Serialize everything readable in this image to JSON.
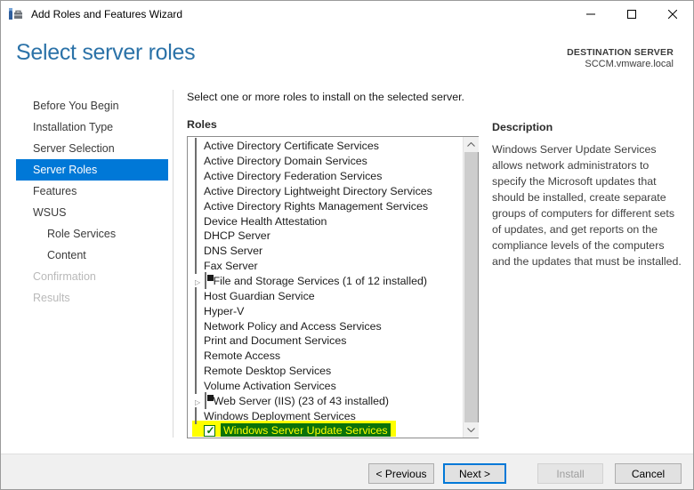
{
  "window": {
    "title": "Add Roles and Features Wizard"
  },
  "header": {
    "title": "Select server roles",
    "destination_label": "DESTINATION SERVER",
    "destination_server": "SCCM.vmware.local"
  },
  "sidebar": {
    "items": [
      {
        "label": "Before You Begin",
        "state": "normal",
        "indent": 0
      },
      {
        "label": "Installation Type",
        "state": "normal",
        "indent": 0
      },
      {
        "label": "Server Selection",
        "state": "normal",
        "indent": 0
      },
      {
        "label": "Server Roles",
        "state": "selected",
        "indent": 0
      },
      {
        "label": "Features",
        "state": "normal",
        "indent": 0
      },
      {
        "label": "WSUS",
        "state": "normal",
        "indent": 0
      },
      {
        "label": "Role Services",
        "state": "normal",
        "indent": 1
      },
      {
        "label": "Content",
        "state": "normal",
        "indent": 1
      },
      {
        "label": "Confirmation",
        "state": "disabled",
        "indent": 0
      },
      {
        "label": "Results",
        "state": "disabled",
        "indent": 0
      }
    ]
  },
  "main": {
    "instruction": "Select one or more roles to install on the selected server.",
    "roles_label": "Roles",
    "roles": [
      {
        "label": "Active Directory Certificate Services",
        "check": "unchecked",
        "expandable": false,
        "highlighted": false
      },
      {
        "label": "Active Directory Domain Services",
        "check": "unchecked",
        "expandable": false,
        "highlighted": false
      },
      {
        "label": "Active Directory Federation Services",
        "check": "unchecked",
        "expandable": false,
        "highlighted": false
      },
      {
        "label": "Active Directory Lightweight Directory Services",
        "check": "unchecked",
        "expandable": false,
        "highlighted": false
      },
      {
        "label": "Active Directory Rights Management Services",
        "check": "unchecked",
        "expandable": false,
        "highlighted": false
      },
      {
        "label": "Device Health Attestation",
        "check": "unchecked",
        "expandable": false,
        "highlighted": false
      },
      {
        "label": "DHCP Server",
        "check": "unchecked",
        "expandable": false,
        "highlighted": false
      },
      {
        "label": "DNS Server",
        "check": "unchecked",
        "expandable": false,
        "highlighted": false
      },
      {
        "label": "Fax Server",
        "check": "unchecked",
        "expandable": false,
        "highlighted": false
      },
      {
        "label": "File and Storage Services (1 of 12 installed)",
        "check": "partial",
        "expandable": true,
        "highlighted": false
      },
      {
        "label": "Host Guardian Service",
        "check": "unchecked",
        "expandable": false,
        "highlighted": false
      },
      {
        "label": "Hyper-V",
        "check": "unchecked",
        "expandable": false,
        "highlighted": false
      },
      {
        "label": "Network Policy and Access Services",
        "check": "unchecked",
        "expandable": false,
        "highlighted": false
      },
      {
        "label": "Print and Document Services",
        "check": "unchecked",
        "expandable": false,
        "highlighted": false
      },
      {
        "label": "Remote Access",
        "check": "unchecked",
        "expandable": false,
        "highlighted": false
      },
      {
        "label": "Remote Desktop Services",
        "check": "unchecked",
        "expandable": false,
        "highlighted": false
      },
      {
        "label": "Volume Activation Services",
        "check": "unchecked",
        "expandable": false,
        "highlighted": false
      },
      {
        "label": "Web Server (IIS) (23 of 43 installed)",
        "check": "partial",
        "expandable": true,
        "highlighted": false
      },
      {
        "label": "Windows Deployment Services",
        "check": "unchecked",
        "expandable": false,
        "highlighted": false
      },
      {
        "label": "Windows Server Update Services",
        "check": "checked",
        "expandable": false,
        "highlighted": true
      }
    ],
    "expand_arrow_glyph": "▷",
    "check_glyph": "✓"
  },
  "description": {
    "heading": "Description",
    "text": "Windows Server Update Services allows network administrators to specify the Microsoft updates that should be installed, create separate groups of computers for different sets of updates, and get reports on the compliance levels of the computers and the updates that must be installed."
  },
  "footer": {
    "buttons": [
      {
        "label": "< Previous",
        "state": "enabled",
        "kind": "previous"
      },
      {
        "label": "Next >",
        "state": "focused",
        "kind": "next"
      },
      {
        "label": "Install",
        "state": "disabled",
        "kind": "install"
      },
      {
        "label": "Cancel",
        "state": "enabled",
        "kind": "cancel"
      }
    ]
  },
  "colors": {
    "nav_selected_bg": "#0078d7",
    "heading_blue": "#2b72a8",
    "highlight_yellow": "#ffff00",
    "highlight_green": "#0a720a",
    "focus_border": "#0078d7",
    "footer_bg": "#f0f0f0"
  }
}
